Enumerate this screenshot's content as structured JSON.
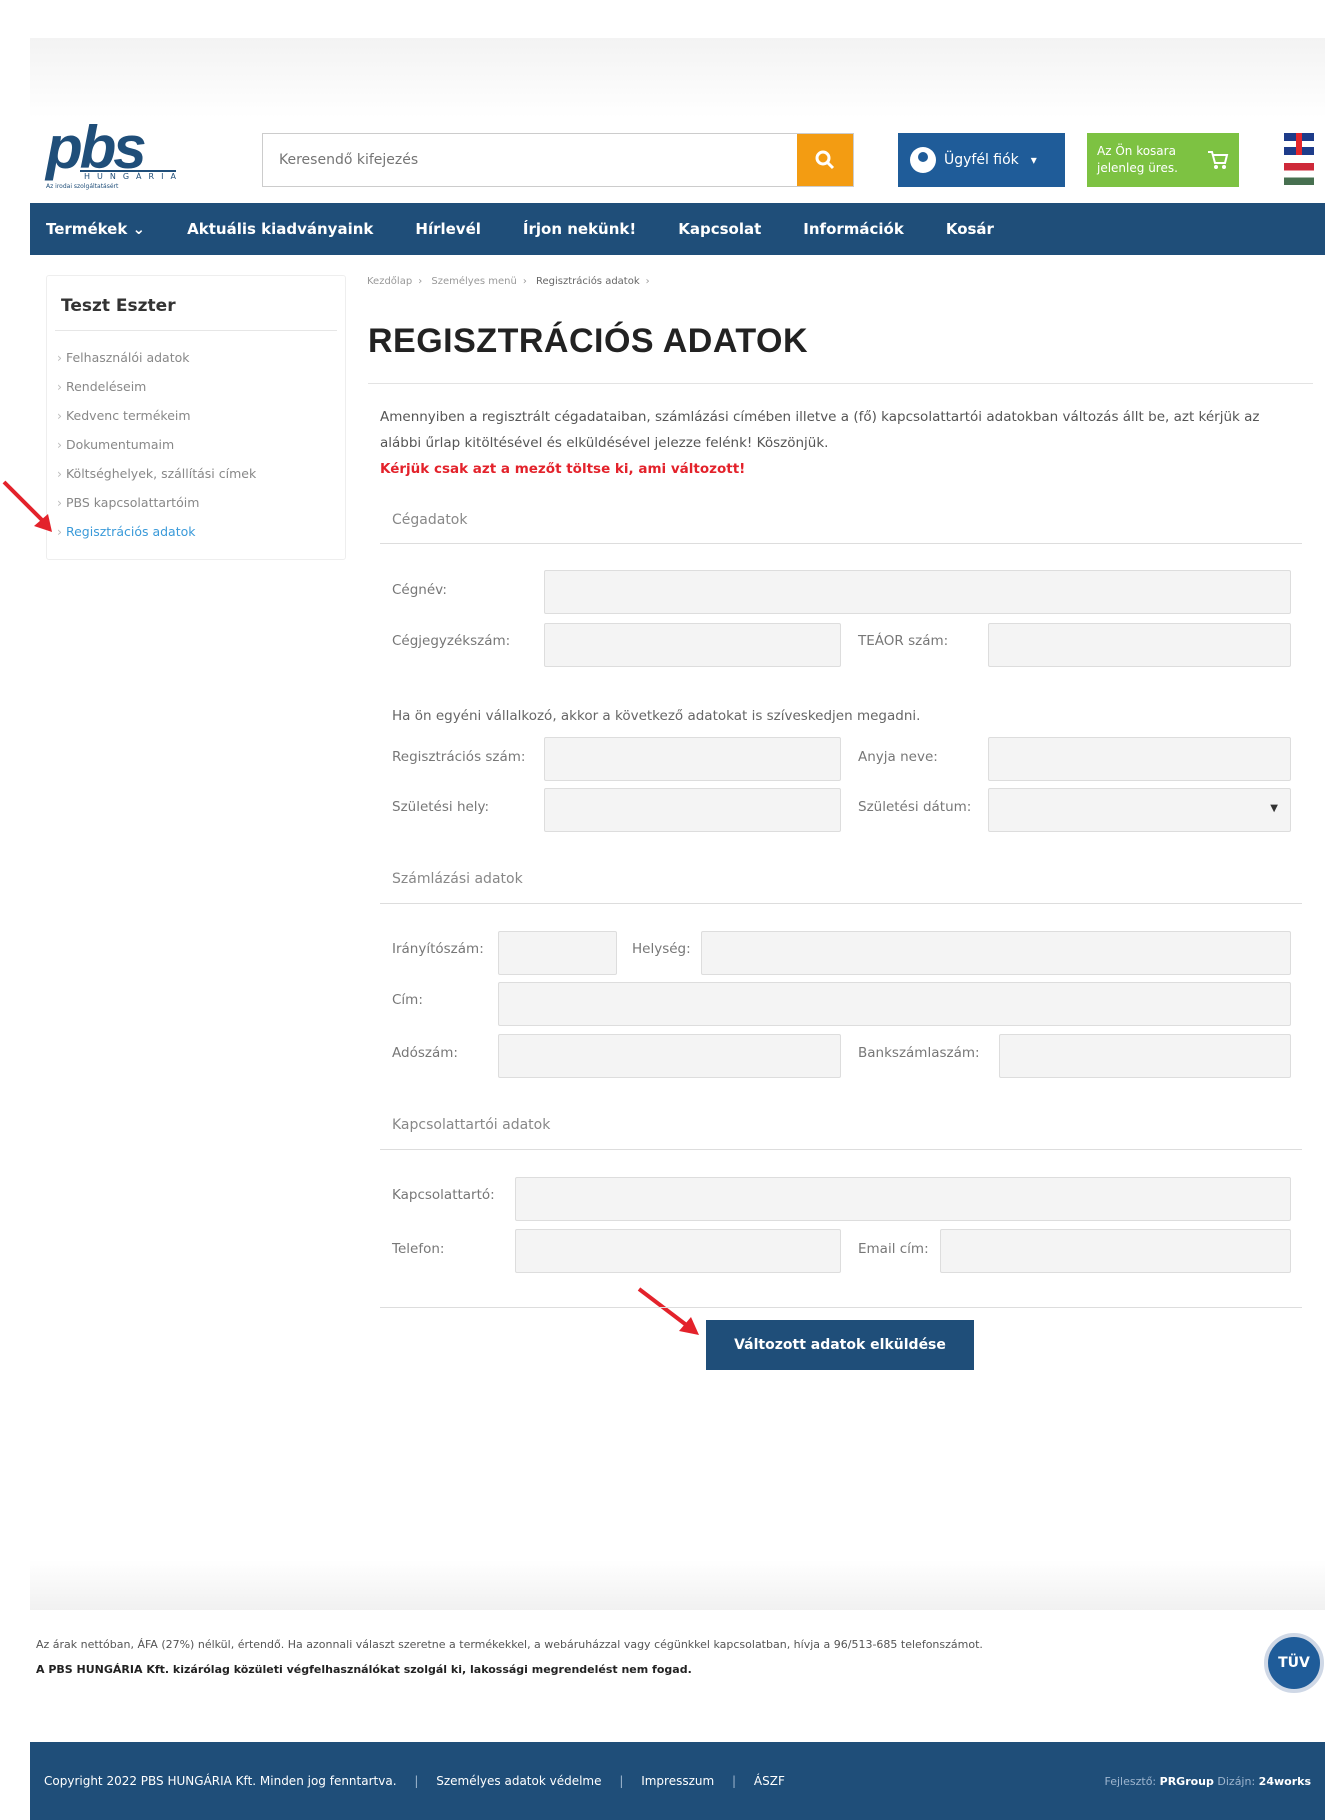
{
  "header": {
    "logo_text": "pbs",
    "logo_sub": "HUNGÁRIA",
    "logo_tagline": "Az irodai szolgáltatásért",
    "search_placeholder": "Keresendő kifejezés",
    "account_label": "Ügyfél fiók",
    "cart_text": "Az Ön kosara jelenleg üres.",
    "colors": {
      "nav": "#1f4e79",
      "search_button": "#f39c12",
      "account": "#1f5c99",
      "cart": "#7dc242"
    }
  },
  "nav": {
    "items": [
      "Termékek ⌄",
      "Aktuális kiadványaink",
      "Hírlevél",
      "Írjon nekünk!",
      "Kapcsolat",
      "Információk",
      "Kosár"
    ]
  },
  "sidebar": {
    "user": "Teszt Eszter",
    "items": [
      {
        "label": "Felhasználói adatok"
      },
      {
        "label": "Rendeléseim"
      },
      {
        "label": "Kedvenc termékeim"
      },
      {
        "label": "Dokumentumaim"
      },
      {
        "label": "Költséghelyek, szállítási címek"
      },
      {
        "label": "PBS kapcsolattartóim"
      },
      {
        "label": "Regisztrációs adatok"
      }
    ]
  },
  "breadcrumb": [
    "Kezdőlap",
    "Személyes menü",
    "Regisztrációs adatok"
  ],
  "page_title": "REGISZTRÁCIÓS ADATOK",
  "intro": {
    "text": "Amennyiben a regisztrált cégadataiban, számlázási címében illetve a (fő) kapcsolattartói adatokban változás állt be, azt kérjük az alábbi űrlap kitöltésével és elküldésével jelezze felénk! Köszönjük.",
    "warning": "Kérjük csak azt a mezőt töltse ki, ami változott!"
  },
  "sections": {
    "company": "Cégadatok",
    "billing": "Számlázási adatok",
    "contact": "Kapcsolattartói adatok"
  },
  "labels": {
    "company_name": "Cégnév:",
    "reg_number": "Cégjegyzékszám:",
    "teaor": "TEÁOR szám:",
    "sole_trader_note": "Ha ön egyéni vállalkozó, akkor a következő adatokat is szíveskedjen megadni.",
    "reg_no": "Regisztrációs szám:",
    "mother_name": "Anyja neve:",
    "birth_place": "Születési hely:",
    "birth_date": "Születési dátum:",
    "zip": "Irányítószám:",
    "city": "Helység:",
    "address": "Cím:",
    "tax_no": "Adószám:",
    "bank_account": "Bankszámlaszám:",
    "contact_person": "Kapcsolattartó:",
    "phone": "Telefon:",
    "email": "Email cím:"
  },
  "submit_label": "Változott adatok elküldése",
  "footer": {
    "info": "Az árak nettóban, ÁFA (27%) nélkül, értendő. Ha azonnali választ szeretne a termékekkel, a webáruházzal vagy cégünkkel kapcsolatban, hívja a 96/513-685 telefonszámot.",
    "notice": "A PBS HUNGÁRIA Kft. kizárólag közületi végfelhasználókat szolgál ki, lakossági megrendelést nem fogad.",
    "copyright": "Copyright 2022 PBS HUNGÁRIA Kft. Minden jog fenntartva.",
    "links": [
      "Személyes adatok védelme",
      "Impresszum",
      "ÁSZF"
    ],
    "dev_label": "Fejlesztő:",
    "dev": "PRGroup",
    "design_label": "Dizájn:",
    "design": "24works",
    "badge": "TÜV"
  }
}
